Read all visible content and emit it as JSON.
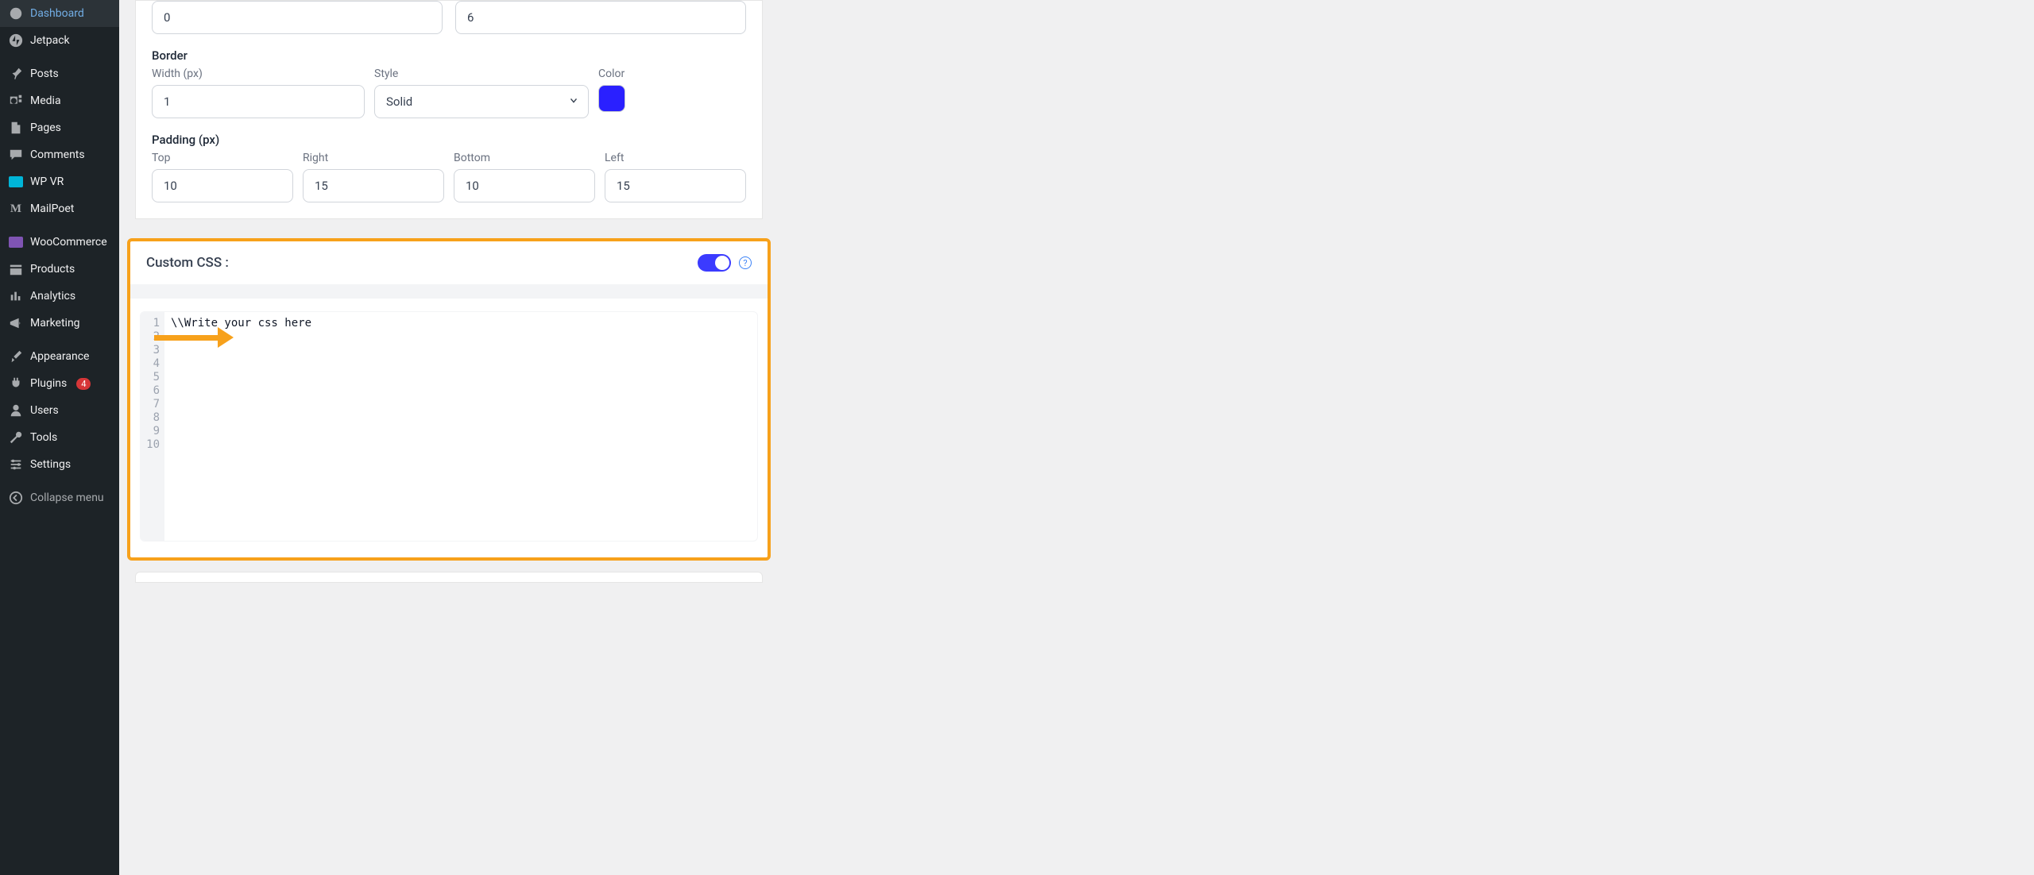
{
  "sidebar": {
    "items": [
      {
        "id": "dashboard",
        "label": "Dashboard"
      },
      {
        "id": "jetpack",
        "label": "Jetpack"
      },
      {
        "id": "posts",
        "label": "Posts"
      },
      {
        "id": "media",
        "label": "Media"
      },
      {
        "id": "pages",
        "label": "Pages"
      },
      {
        "id": "comments",
        "label": "Comments"
      },
      {
        "id": "wpvr",
        "label": "WP VR"
      },
      {
        "id": "mailpoet",
        "label": "MailPoet"
      },
      {
        "id": "woocommerce",
        "label": "WooCommerce"
      },
      {
        "id": "products",
        "label": "Products"
      },
      {
        "id": "analytics",
        "label": "Analytics"
      },
      {
        "id": "marketing",
        "label": "Marketing"
      },
      {
        "id": "appearance",
        "label": "Appearance"
      },
      {
        "id": "plugins",
        "label": "Plugins",
        "badge": "4"
      },
      {
        "id": "users",
        "label": "Users"
      },
      {
        "id": "tools",
        "label": "Tools"
      },
      {
        "id": "settings",
        "label": "Settings"
      },
      {
        "id": "collapse",
        "label": "Collapse menu"
      }
    ]
  },
  "top_inputs": {
    "left": "0",
    "right": "6"
  },
  "border": {
    "title": "Border",
    "width_label": "Width (px)",
    "width_value": "1",
    "style_label": "Style",
    "style_value": "Solid",
    "color_label": "Color",
    "color_value": "#2a20ff"
  },
  "padding": {
    "title": "Padding (px)",
    "fields": [
      {
        "label": "Top",
        "value": "10"
      },
      {
        "label": "Right",
        "value": "15"
      },
      {
        "label": "Bottom",
        "value": "10"
      },
      {
        "label": "Left",
        "value": "15"
      }
    ]
  },
  "custom_css": {
    "title": "Custom CSS :",
    "enabled": true,
    "help": "?",
    "line_numbers": [
      "1",
      "2",
      "3",
      "4",
      "5",
      "6",
      "7",
      "8",
      "9",
      "10"
    ],
    "content_line1": "\\\\Write your css here"
  }
}
